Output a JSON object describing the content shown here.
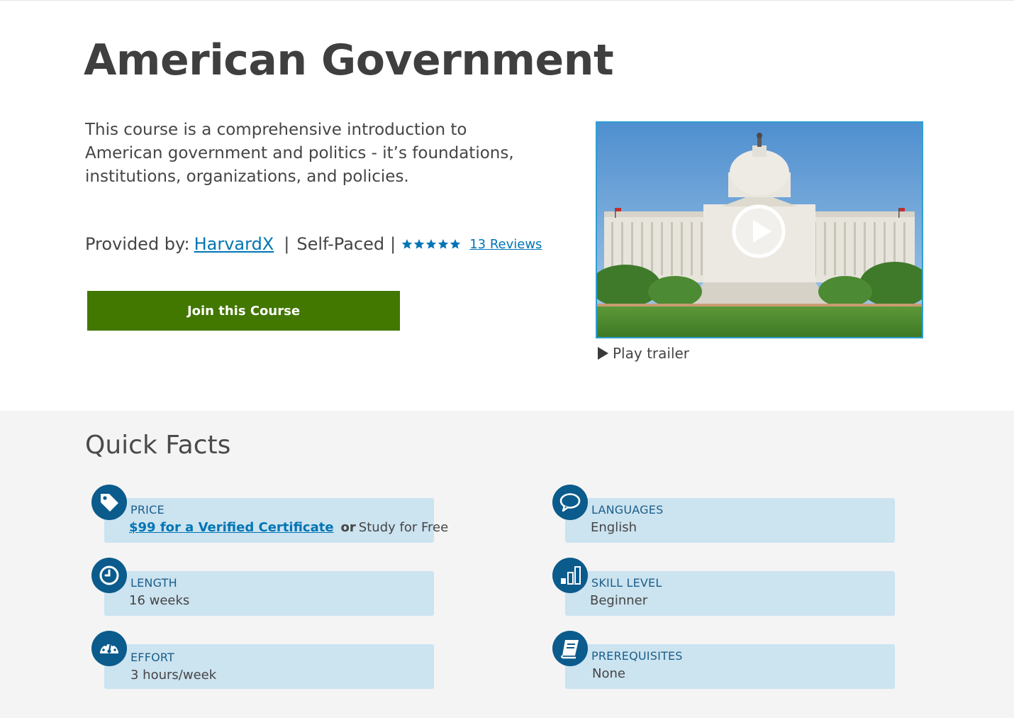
{
  "course": {
    "title": "American Government",
    "description": "This course is a comprehensive introduction to American government and politics - it’s foundations, institutions, organizations, and policies.",
    "provided_by_label": "Provided by:",
    "provider": "HarvardX",
    "pace": "Self-Paced",
    "rating_stars": 5,
    "reviews_link": "13 Reviews",
    "join_button": "Join this Course",
    "trailer_label": "Play trailer"
  },
  "quick_facts": {
    "title": "Quick Facts",
    "price": {
      "label": "PRICE",
      "certificate_link": "$99 for a Verified Certificate",
      "or": "or",
      "free": "Study for Free",
      "icon": "tag-icon"
    },
    "length": {
      "label": "LENGTH",
      "value": "16 weeks",
      "icon": "clock-icon"
    },
    "effort": {
      "label": "EFFORT",
      "value": "3 hours/week",
      "icon": "gauge-icon"
    },
    "languages": {
      "label": "LANGUAGES",
      "value": "English",
      "icon": "speech-bubble-icon"
    },
    "skill_level": {
      "label": "SKILL LEVEL",
      "value": "Beginner",
      "icon": "bar-chart-icon"
    },
    "prerequisites": {
      "label": "PREREQUISITES",
      "value": "None",
      "icon": "book-icon"
    }
  },
  "colors": {
    "join_button": "#427700",
    "link": "#0075b4",
    "fact_bg": "#cce3f0",
    "fact_icon_bg": "#0b5b8c",
    "facts_section_bg": "#f4f4f4"
  }
}
